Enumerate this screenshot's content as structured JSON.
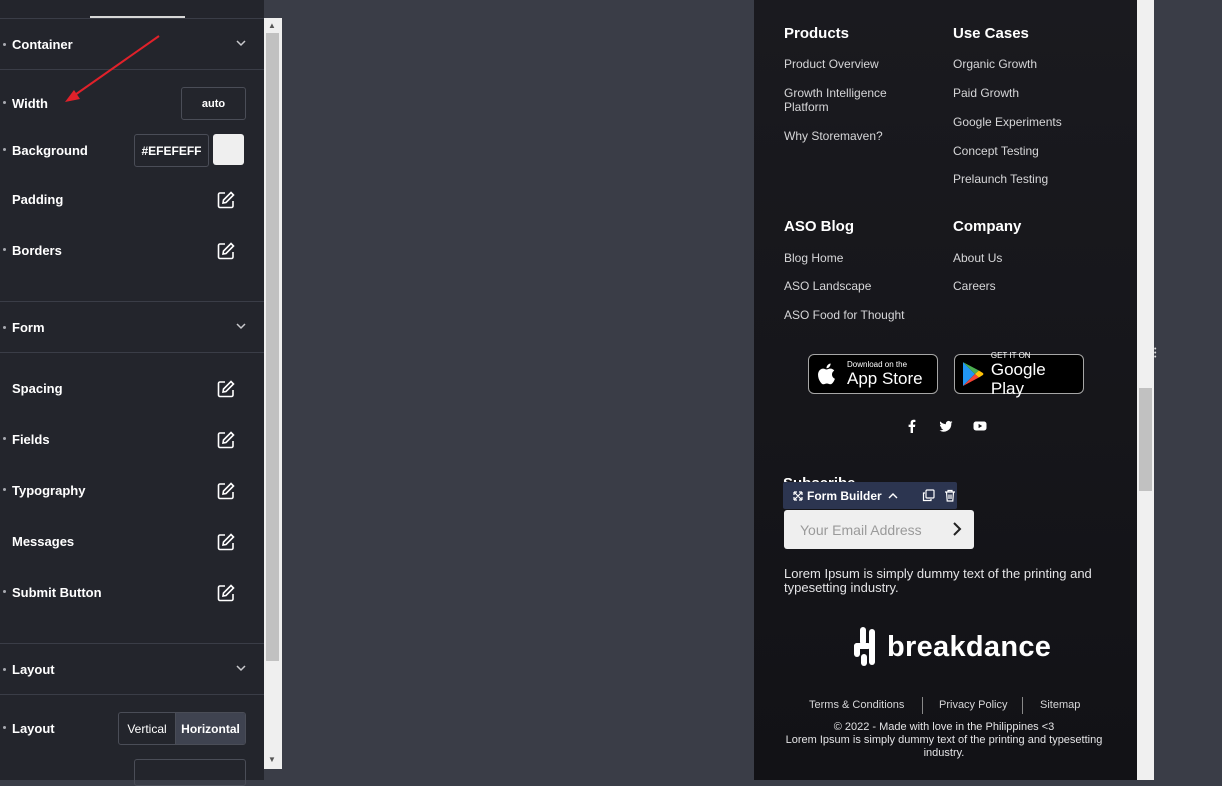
{
  "panel": {
    "sections": {
      "container": "Container",
      "form": "Form",
      "layout": "Layout"
    },
    "rows": {
      "width": "Width",
      "width_value": "auto",
      "background": "Background",
      "background_value": "#EFEFEFF",
      "padding": "Padding",
      "borders": "Borders",
      "spacing": "Spacing",
      "fields": "Fields",
      "typography": "Typography",
      "messages": "Messages",
      "submit_button": "Submit Button",
      "layout": "Layout"
    },
    "layout_options": {
      "vertical": "Vertical",
      "horizontal": "Horizontal",
      "selected": "Horizontal"
    },
    "colors": {
      "background_swatch": "#efefef",
      "annotation_arrow": "#e0212a"
    }
  },
  "footer": {
    "columns": [
      {
        "title": "Products",
        "links": [
          "Product Overview",
          "Growth Intelligence Platform",
          "Why Storemaven?"
        ]
      },
      {
        "title": "Use Cases",
        "links": [
          "Organic Growth",
          "Paid Growth",
          "Google Experiments",
          "Concept Testing",
          "Prelaunch Testing"
        ]
      },
      {
        "title": "ASO Blog",
        "links": [
          "Blog Home",
          "ASO Landscape",
          "ASO Food for Thought"
        ]
      },
      {
        "title": "Company",
        "links": [
          "About Us",
          "Careers"
        ]
      }
    ],
    "app_store": {
      "small": "Download on the",
      "big": "App Store"
    },
    "google_play": {
      "small": "GET IT ON",
      "big": "Google Play"
    },
    "social_icons": [
      "facebook-icon",
      "twitter-icon",
      "youtube-icon"
    ],
    "subscribe_title": "Subscribe",
    "form_builder_label": "Form Builder",
    "email_placeholder": "Your Email Address",
    "description": "Lorem Ipsum is simply dummy text of the printing and typesetting industry.",
    "logo_text": "breakdance",
    "legal": [
      "Terms & Conditions",
      "Privacy Policy",
      "Sitemap"
    ],
    "copyright_line1": "© 2022 - Made with love in the Philippines <3",
    "copyright_line2": "Lorem Ipsum is simply dummy text of the printing and typesetting industry."
  }
}
